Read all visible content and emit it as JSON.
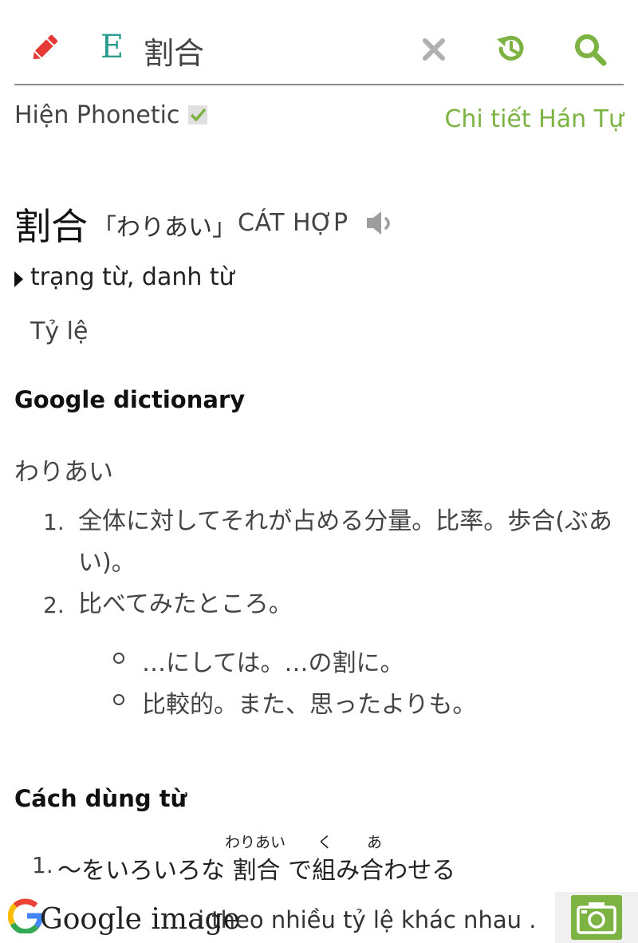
{
  "search": {
    "query": "割合",
    "mode_letter": "E"
  },
  "toolbar": {
    "edit_icon": "pencil-icon",
    "clear_icon": "close-icon",
    "history_icon": "history-icon",
    "search_icon": "search-icon"
  },
  "options": {
    "phonetic_label": "Hiện Phonetic",
    "phonetic_checked": true,
    "kanji_detail_link": "Chi tiết Hán Tự"
  },
  "entry": {
    "word": "割合",
    "reading": "「わりあい」",
    "han_viet": "CÁT HỢP",
    "part_of_speech": "trạng từ, danh từ",
    "meaning": "Tỷ lệ"
  },
  "google_dictionary": {
    "title": "Google dictionary",
    "kana": "わりあい",
    "definitions": [
      {
        "num": "1.",
        "line1": "全体に対してそれが占める分量。比率。歩合(ぶあ",
        "line2": "い)。"
      },
      {
        "num": "2.",
        "line1": "比べてみたところ。"
      }
    ],
    "sub_items": [
      "…にしては。…の割に。",
      "比較的。また、思ったよりも。"
    ]
  },
  "usage": {
    "title": "Cách dùng từ",
    "num": "1.",
    "sentence": "～をいろいろな 割合 で組み合わせる",
    "ruby": {
      "wariai": "わりあい",
      "ku": "く",
      "a": "あ"
    },
    "translation_fragment": "i theo nhiều tỷ lệ khác nhau ."
  },
  "bottom": {
    "google_image_label": "Google image",
    "camera_icon": "camera-icon"
  },
  "colors": {
    "accent_green": "#7cb342",
    "edit_red": "#e53935",
    "teal": "#2a9d8f"
  }
}
